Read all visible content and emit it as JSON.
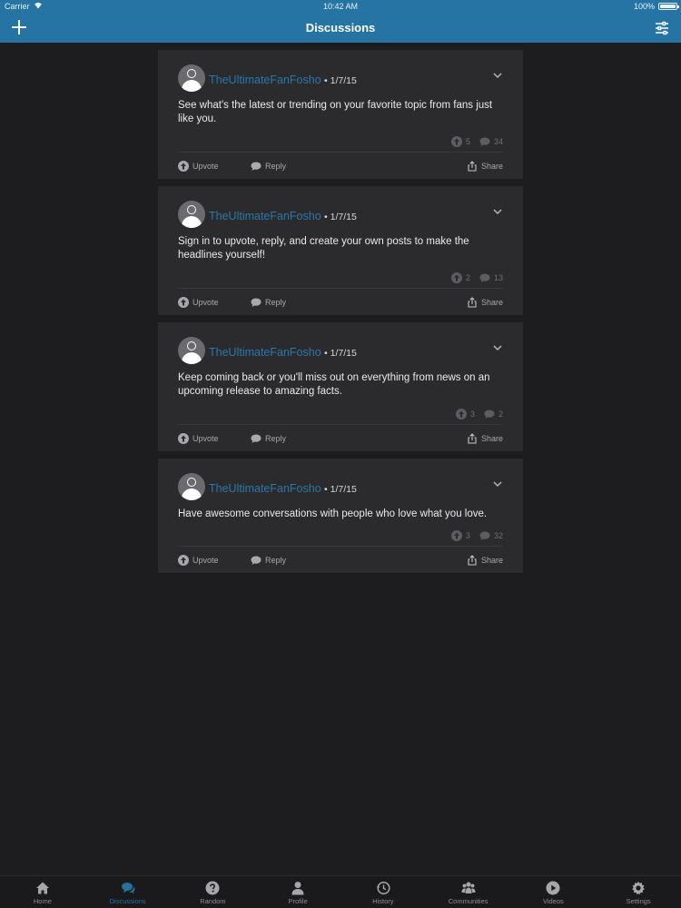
{
  "status_bar": {
    "carrier": "Carrier",
    "time": "10:42 AM",
    "battery": "100%"
  },
  "header": {
    "title": "Discussions"
  },
  "labels": {
    "upvote": "Upvote",
    "reply": "Reply",
    "share": "Share"
  },
  "posts": [
    {
      "user": "TheUltimateFanFosho",
      "date": "• 1/7/15",
      "text": "See what's the latest or trending on your favorite topic from fans just like you.",
      "upvotes": "5",
      "comments": "34"
    },
    {
      "user": "TheUltimateFanFosho",
      "date": "• 1/7/15",
      "text": "Sign in to upvote, reply, and create your own posts to make the headlines yourself!",
      "upvotes": "2",
      "comments": "13"
    },
    {
      "user": "TheUltimateFanFosho",
      "date": "• 1/7/15",
      "text": "Keep coming back or you'll miss out on everything from news on an upcoming release to amazing facts.",
      "upvotes": "3",
      "comments": "2"
    },
    {
      "user": "TheUltimateFanFosho",
      "date": "• 1/7/15",
      "text": "Have awesome conversations with people who love what you love.",
      "upvotes": "3",
      "comments": "32"
    }
  ],
  "tabs": [
    {
      "label": "Home",
      "icon": "home-icon"
    },
    {
      "label": "Discussions",
      "icon": "chat-bubbles-icon",
      "active": true
    },
    {
      "label": "Random",
      "icon": "question-icon"
    },
    {
      "label": "Profile",
      "icon": "person-icon"
    },
    {
      "label": "History",
      "icon": "clock-icon"
    },
    {
      "label": "Communities",
      "icon": "group-icon"
    },
    {
      "label": "Videos",
      "icon": "play-icon"
    },
    {
      "label": "Settings",
      "icon": "gear-icon"
    }
  ],
  "colors": {
    "nav_bar": "#2574a3",
    "background": "#1d1d1f",
    "card": "#2b2b2d",
    "username": "#2a77aa"
  }
}
